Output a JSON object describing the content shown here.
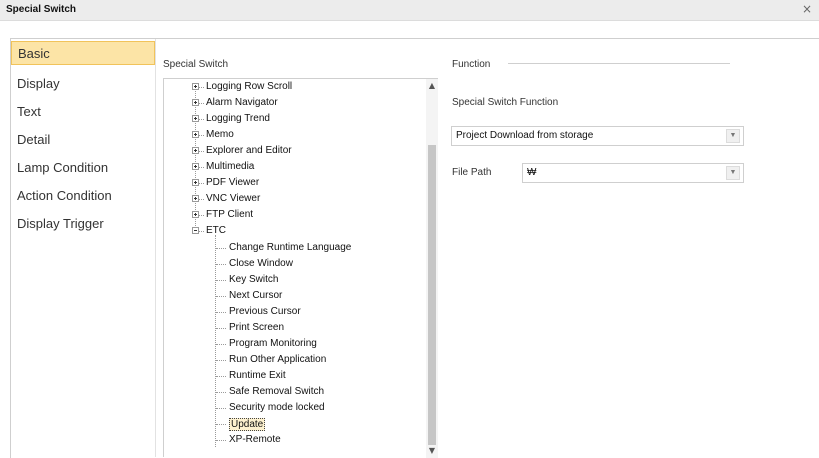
{
  "window": {
    "title": "Special Switch",
    "close_glyph": "×"
  },
  "nav": {
    "items": [
      {
        "label": "Basic",
        "active": true
      },
      {
        "label": "Display"
      },
      {
        "label": "Text"
      },
      {
        "label": "Detail"
      },
      {
        "label": "Lamp Condition"
      },
      {
        "label": "Action Condition"
      },
      {
        "label": "Display Trigger"
      }
    ]
  },
  "tree_panel": {
    "label": "Special Switch",
    "nodes": [
      {
        "label": "Logging Row Scroll",
        "expander": "plus"
      },
      {
        "label": "Alarm Navigator",
        "expander": "plus"
      },
      {
        "label": "Logging Trend",
        "expander": "plus"
      },
      {
        "label": "Memo",
        "expander": "plus"
      },
      {
        "label": "Explorer and Editor",
        "expander": "plus"
      },
      {
        "label": "Multimedia",
        "expander": "plus"
      },
      {
        "label": "PDF Viewer",
        "expander": "plus"
      },
      {
        "label": "VNC Viewer",
        "expander": "plus"
      },
      {
        "label": "FTP Client",
        "expander": "plus"
      },
      {
        "label": "ETC",
        "expander": "minus"
      }
    ],
    "etc_children": [
      "Change Runtime Language",
      "Close Window",
      "Key Switch",
      "Next Cursor",
      "Previous Cursor",
      "Print Screen",
      "Program Monitoring",
      "Run Other Application",
      "Runtime Exit",
      "Safe Removal Switch",
      "Security mode locked",
      "Update",
      "XP-Remote"
    ],
    "selected": "Update",
    "scroll_up_glyph": "▲",
    "scroll_down_glyph": "▼"
  },
  "function_panel": {
    "group_label": "Function",
    "special_switch_function_label": "Special Switch Function",
    "function_value": "Project Download from storage",
    "file_path_label": "File Path",
    "file_path_value": "₩",
    "dropdown_glyph": "▼"
  }
}
